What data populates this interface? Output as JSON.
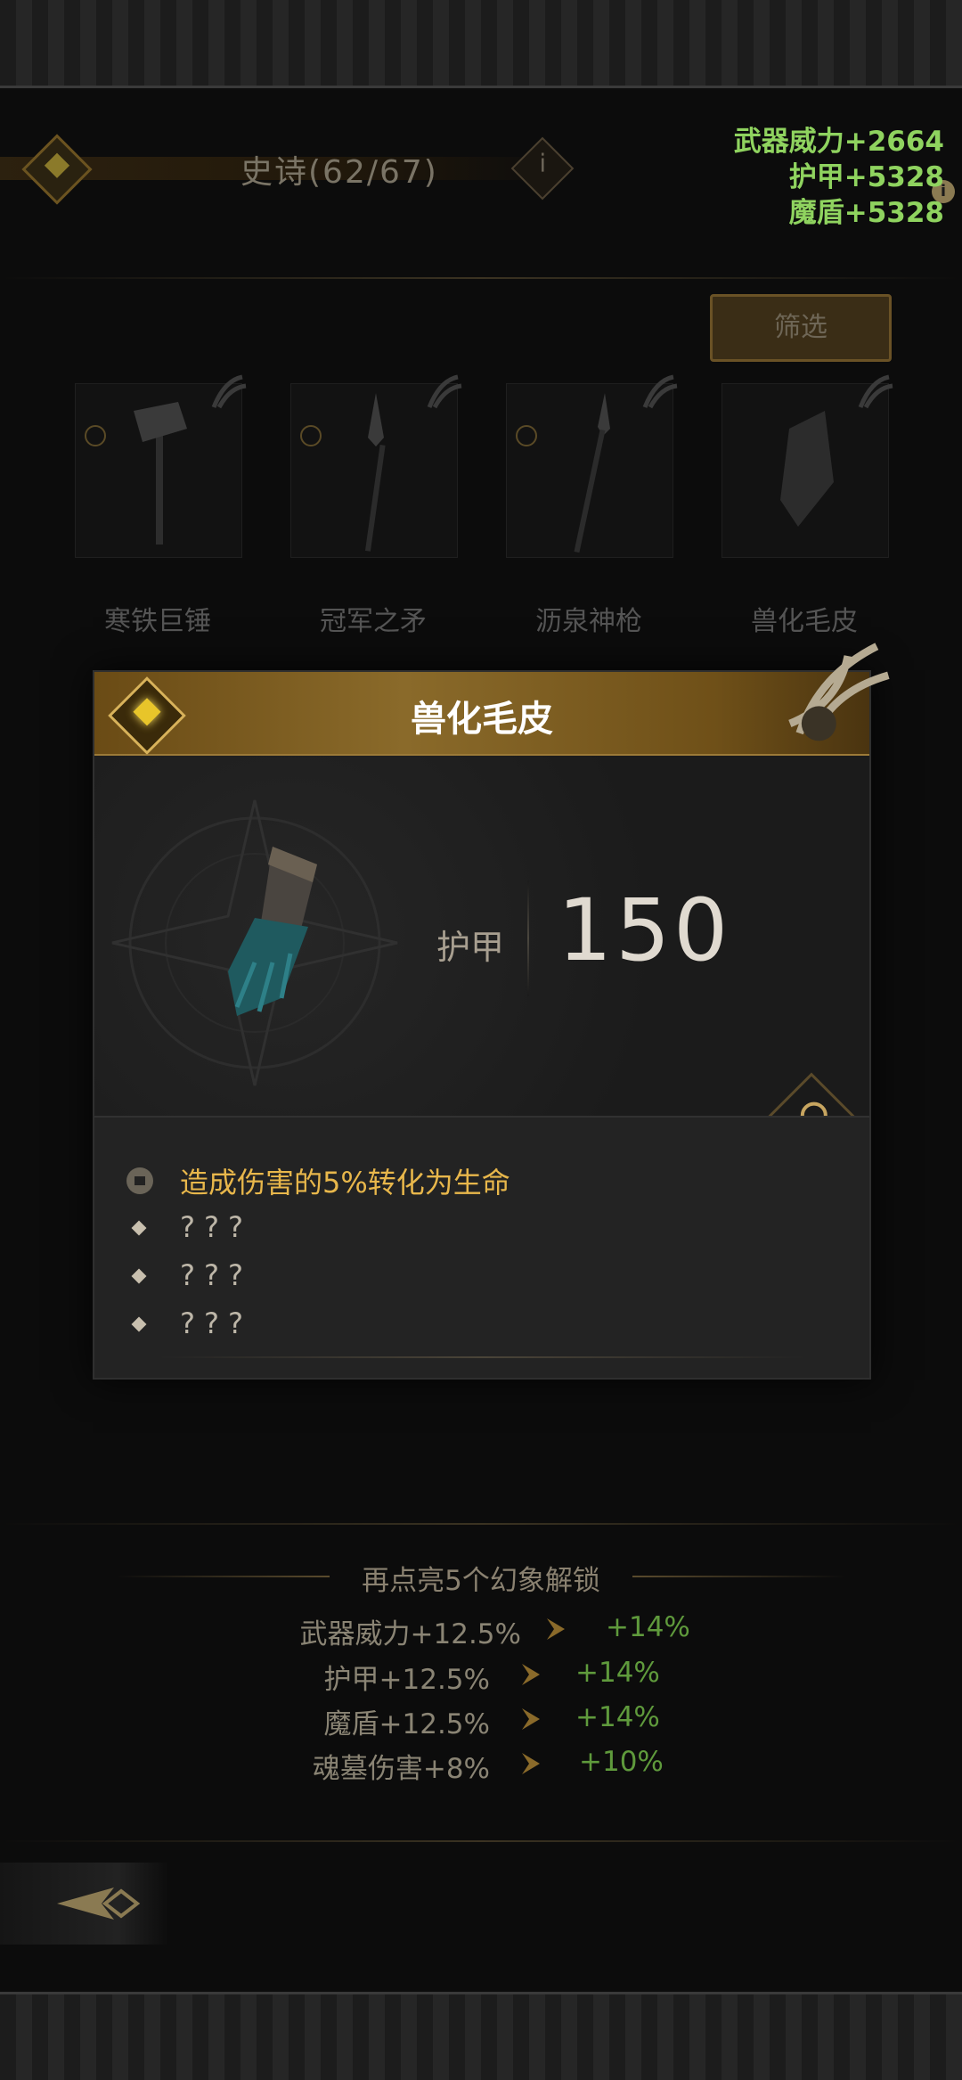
{
  "header": {
    "category_title": "史诗(62/67)",
    "info_glyph": "i"
  },
  "totals": {
    "weapon_power": "武器威力+2664",
    "armor": "护甲+5328",
    "magic_shield": "魔盾+5328"
  },
  "filter_label": "筛选",
  "grid_items": [
    {
      "label": "寒铁巨锤"
    },
    {
      "label": "冠军之矛"
    },
    {
      "label": "沥泉神枪"
    },
    {
      "label": "兽化毛皮"
    }
  ],
  "popup": {
    "title": "兽化毛皮",
    "stat_label": "护甲",
    "stat_value": "150",
    "effects": [
      {
        "text": "造成伤害的5%转化为生命",
        "locked": false
      },
      {
        "text": "???",
        "locked": true
      },
      {
        "text": "???",
        "locked": true
      },
      {
        "text": "???",
        "locked": true
      }
    ]
  },
  "bonus": {
    "title": "再点亮5个幻象解锁",
    "rows": [
      {
        "current": "武器威力+12.5%",
        "next": "+14%"
      },
      {
        "current": "护甲+12.5%",
        "next": "+14%"
      },
      {
        "current": "魔盾+12.5%",
        "next": "+14%"
      },
      {
        "current": "魂墓伤害+8%",
        "next": "+10%"
      }
    ]
  },
  "colors": {
    "accent_gold": "#e8b74b",
    "stat_green": "#8fd35f",
    "next_green": "#5f9a3c"
  }
}
